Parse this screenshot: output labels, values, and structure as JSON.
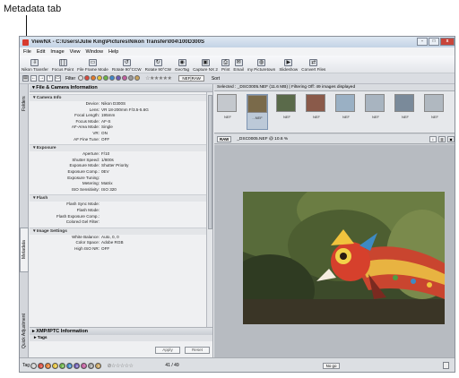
{
  "callout": {
    "label": "Metadata tab"
  },
  "window": {
    "title": "ViewNX - C:\\Users\\Julie King\\Pictures\\Nikon Transfer\\004\\100D300S",
    "controls": {
      "minimize": "-",
      "maximize": "□",
      "close": "x"
    }
  },
  "menu": [
    "File",
    "Edit",
    "Image",
    "View",
    "Window",
    "Help"
  ],
  "toolbar": [
    {
      "label": "Nikon Transfer",
      "icon": "nikon-transfer-icon",
      "glyph": "⇩"
    },
    {
      "label": "Focus Point",
      "icon": "focus-point-icon",
      "glyph": "[ ]"
    },
    {
      "label": "File Frame Mode",
      "icon": "file-frame-mode-icon",
      "glyph": "▭"
    },
    {
      "label": "Rotate 90°CCW",
      "icon": "rotate-ccw-icon",
      "glyph": "↺"
    },
    {
      "label": "Rotate 90°CW",
      "icon": "rotate-cw-icon",
      "glyph": "↻"
    },
    {
      "label": "GeoTag",
      "icon": "geotag-icon",
      "glyph": "◉"
    },
    {
      "label": "Capture NX 2",
      "icon": "capture-nx2-icon",
      "glyph": "▣"
    },
    {
      "label": "Print",
      "icon": "print-icon",
      "glyph": "⎙"
    },
    {
      "label": "Email",
      "icon": "email-icon",
      "glyph": "✉"
    },
    {
      "label": "my Picturetown",
      "icon": "picturetown-icon",
      "glyph": "◍"
    },
    {
      "label": "Slideshow",
      "icon": "slideshow-icon",
      "glyph": "▶"
    },
    {
      "label": "Convert Files",
      "icon": "convert-files-icon",
      "glyph": "⇄"
    }
  ],
  "filterbar": {
    "filter_label": "Filter",
    "dot_colors": [
      "#e0e0e0",
      "#d94a3d",
      "#e27b2f",
      "#e6c33a",
      "#6db54a",
      "#3f88c9",
      "#6b5bb5",
      "#c25fa0",
      "#9b9b9b",
      "#c7a25e"
    ],
    "stars": "☆★★★★★",
    "view": "NEF|RAW",
    "sort_label": "Sort"
  },
  "side_tabs": {
    "folders": "Folders",
    "metadata": "Metadata",
    "quick_adjustment": "Quick Adjustment"
  },
  "metadata": {
    "panel_title": "File & Camera Information",
    "sections": [
      {
        "title": "Camera Info",
        "rows": [
          {
            "k": "Device:",
            "v": "Nikon D300S"
          },
          {
            "k": "Lens:",
            "v": "VR 18-200mm F/3.5-5.6G"
          },
          {
            "k": "Focal Length:",
            "v": "195mm"
          },
          {
            "k": "Focus Mode:",
            "v": "AF-S"
          },
          {
            "k": "AF-Area Mode:",
            "v": "Single"
          },
          {
            "k": "VR:",
            "v": "ON"
          },
          {
            "k": "AF Fine Tune:",
            "v": "OFF"
          }
        ]
      },
      {
        "title": "Exposure",
        "rows": [
          {
            "k": "Aperture:",
            "v": "F/10"
          },
          {
            "k": "Shutter Speed:",
            "v": "1/800s"
          },
          {
            "k": "Exposure Mode:",
            "v": "Shutter Priority"
          },
          {
            "k": "Exposure Comp.:",
            "v": "0EV"
          },
          {
            "k": "Exposure Tuning:",
            "v": ""
          },
          {
            "k": "Metering:",
            "v": "Matrix"
          },
          {
            "k": "ISO Sensitivity:",
            "v": "ISO 320"
          }
        ]
      },
      {
        "title": "Flash",
        "rows": [
          {
            "k": "Flash Sync Mode:",
            "v": ""
          },
          {
            "k": "Flash Mode:",
            "v": ""
          },
          {
            "k": "Flash Exposure Comp.:",
            "v": ""
          },
          {
            "k": "Colored Gel Filter:",
            "v": ""
          }
        ]
      },
      {
        "title": "Image Settings",
        "rows": [
          {
            "k": "White Balance:",
            "v": "Auto, 0, 0"
          },
          {
            "k": "Color Space:",
            "v": "Adobe RGB"
          },
          {
            "k": "High ISO NR:",
            "v": "OFF"
          }
        ]
      }
    ],
    "xmp_title": "XMP/IPTC Information",
    "tags_title": "Tags",
    "apply_label": "Apply",
    "reset_label": "Reset"
  },
  "status": {
    "text": "Selected : _DSC0005.NEF (11.6 MB) | Filtering Off: 49 images displayed"
  },
  "thumbnails": [
    {
      "cap": "NEF",
      "bg": "#c4c8cd"
    },
    {
      "cap": "...NEF",
      "bg": "#7a6a4a",
      "selected": true
    },
    {
      "cap": "NEF",
      "bg": "#5a6a4a"
    },
    {
      "cap": "NEF",
      "bg": "#8a5a4a"
    },
    {
      "cap": "NEF",
      "bg": "#9ab0c4"
    },
    {
      "cap": "NEF",
      "bg": "#a8b4c0"
    },
    {
      "cap": "NEF",
      "bg": "#7a8a9a"
    },
    {
      "cap": "NEF",
      "bg": "#b0b8c0"
    }
  ],
  "viewer": {
    "raw_badge": "RAW",
    "file_label": "_DSC0005.NEF @ 10.6 %"
  },
  "bottombar": {
    "tag_label": "Tag",
    "dots": [
      {
        "n": "0",
        "c": "#cfcfcf"
      },
      {
        "n": "1",
        "c": "#d94a3d"
      },
      {
        "n": "2",
        "c": "#e27b2f"
      },
      {
        "n": "3",
        "c": "#e6c33a"
      },
      {
        "n": "4",
        "c": "#6db54a"
      },
      {
        "n": "5",
        "c": "#3f88c9"
      },
      {
        "n": "6",
        "c": "#6b5bb5"
      },
      {
        "n": "7",
        "c": "#c25fa0"
      },
      {
        "n": "8",
        "c": "#9b9b9b"
      },
      {
        "n": "9",
        "c": "#c7a25e"
      }
    ],
    "stars": "⊘☆☆☆☆☆",
    "counter": "41 / 49",
    "no_go": "No go"
  }
}
